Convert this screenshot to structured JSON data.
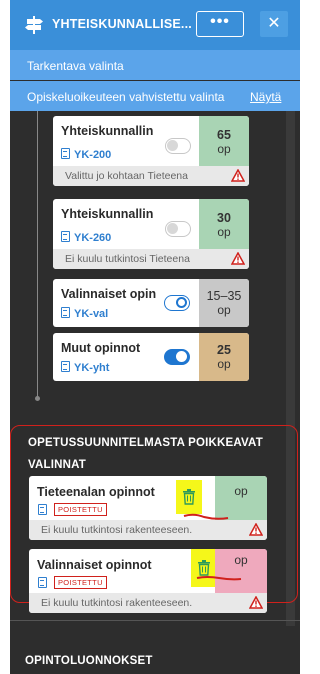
{
  "header": {
    "title": "YHTEISKUNNALLISE...",
    "menu_label": "•••",
    "close_label": "✕"
  },
  "selection_rows": {
    "detailed": "Tarkentava valinta",
    "confirmed": "Opiskeluoikeuteen vahvistettu valinta",
    "show_link": "Näytä"
  },
  "cards": [
    {
      "name": "Yhteiskunnallin",
      "code": "YK-200",
      "credits": "65",
      "unit": "op",
      "note": "Valittu jo kohtaan Tieteena",
      "toggle": "off",
      "credit_color": "#a9d4b4"
    },
    {
      "name": "Yhteiskunnallin",
      "code": "YK-260",
      "credits": "30",
      "unit": "op",
      "note": "Ei kuulu tutkintosi Tieteena",
      "toggle": "off",
      "credit_color": "#a9d4b4"
    },
    {
      "name": "Valinnaiset opin",
      "code": "YK-val",
      "credits": "15–35",
      "unit": "op",
      "toggle": "on",
      "credit_color": "#c8c8c8"
    },
    {
      "name": "Muut opinnot",
      "code": "YK-yht",
      "credits": "25",
      "unit": "op",
      "toggle": "onfill",
      "credit_color": "#d8b98a"
    }
  ],
  "deviating_section": {
    "title": "OPETUSSUUNNITELMASTA POIKKEAVAT VALINNAT",
    "items": [
      {
        "name": "Tieteenalan opinnot",
        "badge": "POISTETTU",
        "unit": "op",
        "note": "Ei kuulu tutkintosi rakenteeseen.",
        "credit_color": "#a9d4b4"
      },
      {
        "name": "Valinnaiset opinnot",
        "badge": "POISTETTU",
        "unit": "op",
        "note": "Ei kuulu tutkintosi rakenteeseen.",
        "credit_color": "#efa9bd"
      }
    ]
  },
  "drafts_section": {
    "title": "OPINTOLUONNOKSET"
  },
  "colors": {
    "header_bg": "#3a8fd9",
    "row_bg": "#5ba4ea",
    "panel_bg": "#2d2d2d",
    "highlight": "#f5f71a",
    "annotation_red": "#d0211c"
  },
  "icons": {
    "header": "signpost-icon",
    "delete": "trash-icon",
    "warning": "warning-triangle-icon",
    "doc": "document-icon"
  }
}
